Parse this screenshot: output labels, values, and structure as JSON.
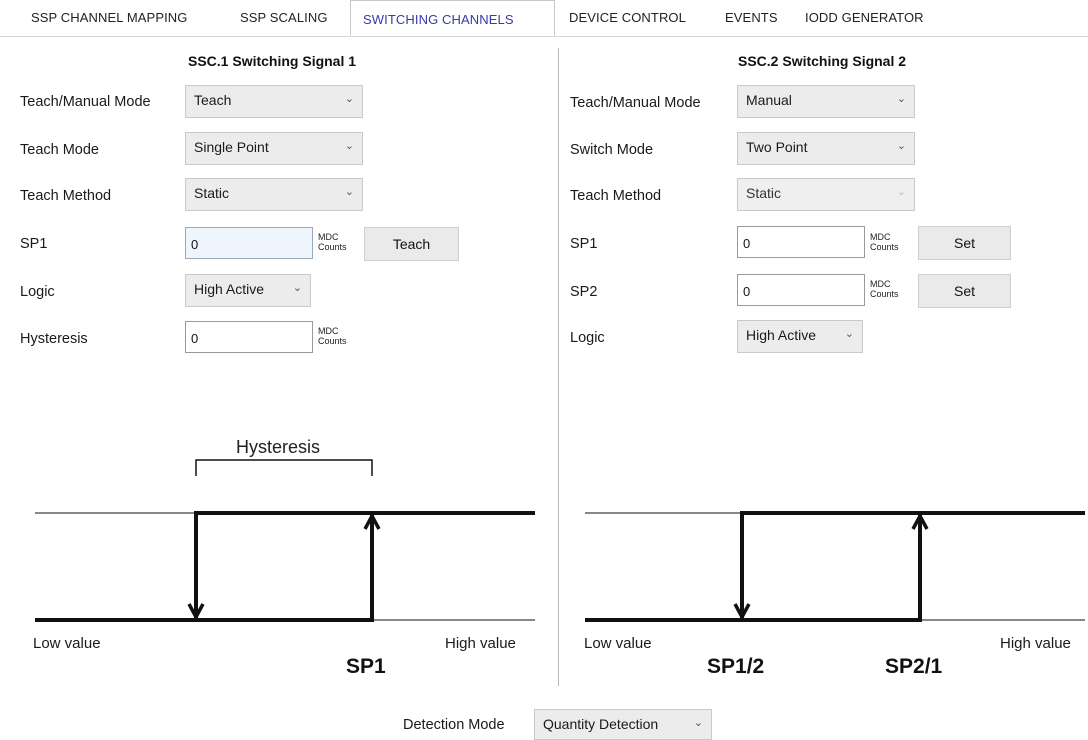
{
  "tabs": [
    {
      "label": "SSP CHANNEL MAPPING",
      "active": false
    },
    {
      "label": "SSP SCALING",
      "active": false
    },
    {
      "label": "SWITCHING CHANNELS",
      "active": true
    },
    {
      "label": "DEVICE CONTROL",
      "active": false
    },
    {
      "label": "EVENTS",
      "active": false
    },
    {
      "label": "IODD GENERATOR",
      "active": false
    }
  ],
  "left": {
    "title": "SSC.1 Switching Signal 1",
    "teach_manual_label": "Teach/Manual Mode",
    "teach_manual_value": "Teach",
    "teach_mode_label": "Teach Mode",
    "teach_mode_value": "Single Point",
    "teach_method_label": "Teach Method",
    "teach_method_value": "Static",
    "sp1_label": "SP1",
    "sp1_value": "0",
    "sp1_unit_1": "MDC",
    "sp1_unit_2": "Counts",
    "teach_button": "Teach",
    "logic_label": "Logic",
    "logic_value": "High Active",
    "hysteresis_label": "Hysteresis",
    "hysteresis_value": "0",
    "hyst_unit_1": "MDC",
    "hyst_unit_2": "Counts",
    "diagram": {
      "hysteresis": "Hysteresis",
      "low": "Low value",
      "high": "High value",
      "sp": "SP1"
    }
  },
  "right": {
    "title": "SSC.2 Switching Signal 2",
    "teach_manual_label": "Teach/Manual Mode",
    "teach_manual_value": "Manual",
    "switch_mode_label": "Switch Mode",
    "switch_mode_value": "Two Point",
    "teach_method_label": "Teach Method",
    "teach_method_value": "Static",
    "sp1_label": "SP1",
    "sp1_value": "0",
    "sp1_unit_1": "MDC",
    "sp1_unit_2": "Counts",
    "sp1_button": "Set",
    "sp2_label": "SP2",
    "sp2_value": "0",
    "sp2_unit_1": "MDC",
    "sp2_unit_2": "Counts",
    "sp2_button": "Set",
    "logic_label": "Logic",
    "logic_value": "High Active",
    "diagram": {
      "low": "Low value",
      "high": "High value",
      "sp_a": "SP1/2",
      "sp_b": "SP2/1"
    }
  },
  "footer": {
    "detection_label": "Detection Mode",
    "detection_value": "Quantity Detection"
  },
  "icons": {
    "combo": "chevron-down-icon"
  }
}
